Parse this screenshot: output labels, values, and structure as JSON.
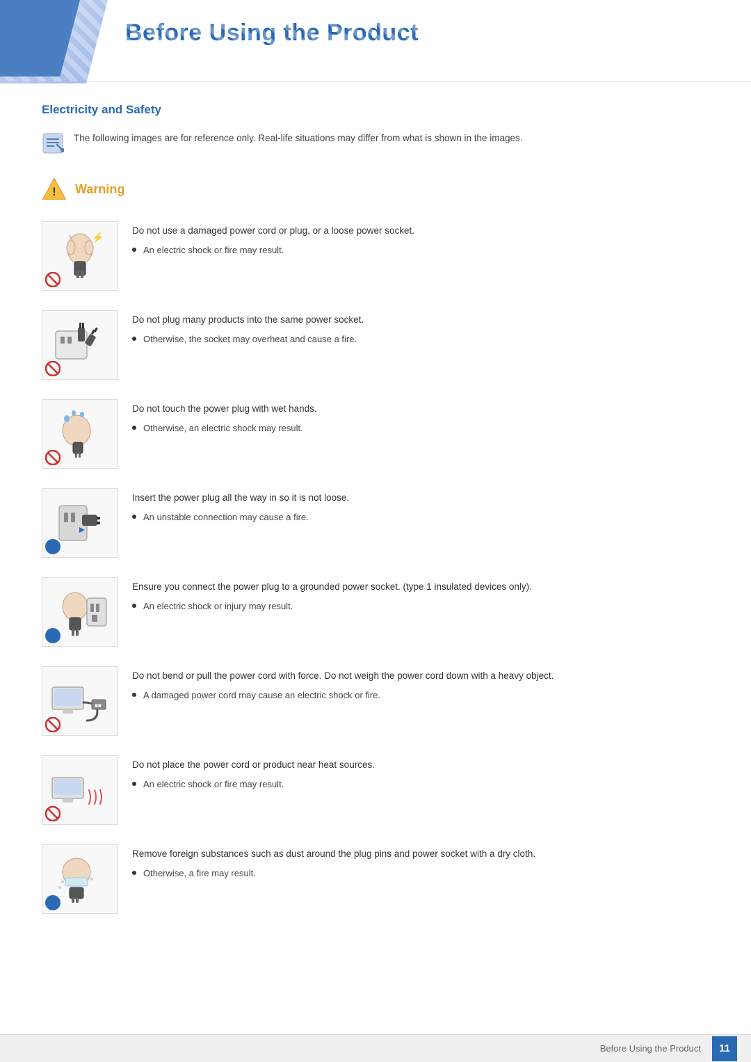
{
  "header": {
    "title": "Before Using the Product"
  },
  "section": {
    "heading": "Electricity and Safety"
  },
  "note": {
    "text": "The following images are for reference only. Real-life situations may differ from what is shown in the images."
  },
  "warning": {
    "label": "Warning"
  },
  "items": [
    {
      "id": 1,
      "main": "Do not use a damaged power cord or plug, or a loose power socket.",
      "sub": "An electric shock or fire may result.",
      "symbol": "no"
    },
    {
      "id": 2,
      "main": "Do not plug many products into the same power socket.",
      "sub": "Otherwise, the socket may overheat and cause a fire.",
      "symbol": "no"
    },
    {
      "id": 3,
      "main": "Do not touch the power plug with wet hands.",
      "sub": "Otherwise, an electric shock may result.",
      "symbol": "no"
    },
    {
      "id": 4,
      "main": "Insert the power plug all the way in so it is not loose.",
      "sub": "An unstable connection may cause a fire.",
      "symbol": "dot"
    },
    {
      "id": 5,
      "main": "Ensure you connect the power plug to a grounded power socket. (type 1 insulated devices only).",
      "sub": "An electric shock or injury may result.",
      "symbol": "dot"
    },
    {
      "id": 6,
      "main": "Do not bend or pull the power cord with force. Do not weigh the power cord down with a heavy object.",
      "sub": "A damaged power cord may cause an electric shock or fire.",
      "symbol": "no"
    },
    {
      "id": 7,
      "main": "Do not place the power cord or product near heat sources.",
      "sub": "An electric shock or fire may result.",
      "symbol": "no"
    },
    {
      "id": 8,
      "main": "Remove foreign substances such as dust around the plug pins and power socket with a dry cloth.",
      "sub": "Otherwise, a fire may result.",
      "symbol": "dot"
    }
  ],
  "footer": {
    "text": "Before Using the Product",
    "page": "11"
  }
}
